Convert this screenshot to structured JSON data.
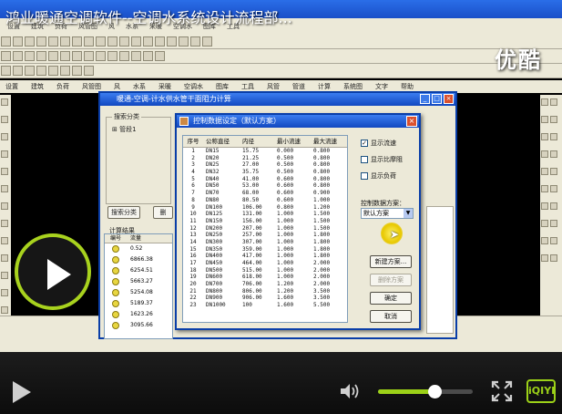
{
  "video": {
    "title": "鸿业暖通空调软件--空调水系统设计流程部...",
    "logo": "优酷"
  },
  "cad": {
    "menu": [
      "设置",
      "建筑",
      "负荷",
      "风管图",
      "风",
      "水系",
      "采暖",
      "空调水",
      "图库",
      "工具",
      "风管",
      "管道",
      "计算",
      "系统图",
      "文字",
      "帮助"
    ]
  },
  "outer_dialog": {
    "title": "暖通-空调-计水供水管干面阻力计算",
    "tree_group_label": "搜索分类",
    "tree_item": "管段1",
    "btn_search": "搜索分类",
    "btn_second": "删",
    "results_label": "计算结果",
    "results_headers": [
      "编号",
      "流量"
    ],
    "results_rows": [
      [
        "1",
        "0.52"
      ],
      [
        "2",
        "6866.38"
      ],
      [
        "3",
        "6254.51"
      ],
      [
        "4",
        "5663.27"
      ],
      [
        "5",
        "5254.08"
      ],
      [
        "6",
        "5189.37"
      ],
      [
        "7",
        "1623.26"
      ],
      [
        "8",
        "3095.66"
      ]
    ]
  },
  "inner_dialog": {
    "title": "控制数据设定（默认方案）",
    "columns": [
      "序号",
      "公称直径",
      "内径",
      "最小流速",
      "最大流速"
    ],
    "rows": [
      [
        "1",
        "DN15",
        "15.75",
        "0.000",
        "0.800"
      ],
      [
        "2",
        "DN20",
        "21.25",
        "0.500",
        "0.800"
      ],
      [
        "3",
        "DN25",
        "27.00",
        "0.500",
        "0.800"
      ],
      [
        "4",
        "DN32",
        "35.75",
        "0.500",
        "0.800"
      ],
      [
        "5",
        "DN40",
        "41.00",
        "0.600",
        "0.800"
      ],
      [
        "6",
        "DN50",
        "53.00",
        "0.600",
        "0.800"
      ],
      [
        "7",
        "DN70",
        "68.00",
        "0.600",
        "0.900"
      ],
      [
        "8",
        "DN80",
        "80.50",
        "0.600",
        "1.000"
      ],
      [
        "9",
        "DN100",
        "106.00",
        "0.800",
        "1.200"
      ],
      [
        "10",
        "DN125",
        "131.00",
        "1.000",
        "1.500"
      ],
      [
        "11",
        "DN150",
        "156.00",
        "1.000",
        "1.500"
      ],
      [
        "12",
        "DN200",
        "207.00",
        "1.000",
        "1.500"
      ],
      [
        "13",
        "DN250",
        "257.00",
        "1.000",
        "1.800"
      ],
      [
        "14",
        "DN300",
        "307.00",
        "1.000",
        "1.800"
      ],
      [
        "15",
        "DN350",
        "359.00",
        "1.000",
        "1.800"
      ],
      [
        "16",
        "DN400",
        "417.00",
        "1.000",
        "1.800"
      ],
      [
        "17",
        "DN450",
        "464.00",
        "1.000",
        "2.000"
      ],
      [
        "18",
        "DN500",
        "515.00",
        "1.000",
        "2.000"
      ],
      [
        "19",
        "DN600",
        "618.00",
        "1.000",
        "2.000"
      ],
      [
        "20",
        "DN700",
        "706.00",
        "1.200",
        "2.000"
      ],
      [
        "21",
        "DN800",
        "806.00",
        "1.200",
        "3.500"
      ],
      [
        "22",
        "DN900",
        "906.00",
        "1.600",
        "3.500"
      ],
      [
        "23",
        "DN1000",
        "100",
        "1.600",
        "5.500"
      ]
    ],
    "check_velocity": "显示流速",
    "check_friction": "显示比摩阻",
    "check_pressure": "显示负荷",
    "scheme_label": "控制数据方案：",
    "scheme_value": "默认方案",
    "btn_new_scheme": "新建方案...",
    "btn_delete_scheme": "删除方案",
    "btn_ok": "确定",
    "btn_cancel": "取消"
  },
  "controls": {
    "volume_level": 0.6,
    "brand": "iQIYI"
  },
  "colors": {
    "accent_green": "#9cd118",
    "xp_blue": "#1248c0"
  }
}
